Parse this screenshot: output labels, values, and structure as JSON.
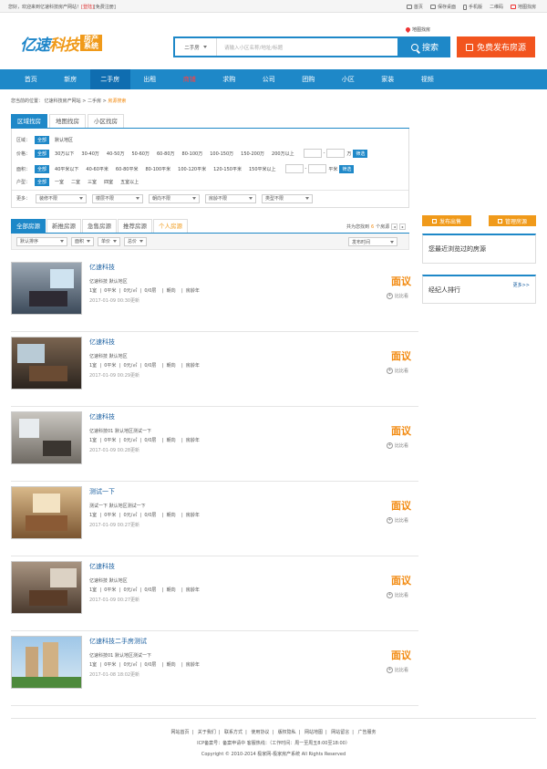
{
  "topbar": {
    "welcome": "您好，欢迎来到亿速科技房产网站！",
    "login": "[登陆]",
    "register": "[免费注册]",
    "links": [
      "首页",
      "保存桌面",
      "手机版",
      "二维码",
      "地图找房"
    ]
  },
  "header": {
    "logo_part1": "亿速",
    "logo_part2": "科技",
    "logo_box": "房产系统",
    "map_link": "地图找房",
    "search_type": "二手房",
    "search_placeholder": "请输入小区名称/地址/标题",
    "search_button": "搜索",
    "publish_button": "免费发布房源"
  },
  "nav": [
    "首页",
    "新房",
    "二手房",
    "出租",
    "商铺",
    "求购",
    "公司",
    "团购",
    "小区",
    "家装",
    "视频"
  ],
  "breadcrumb": {
    "prefix": "您当前的位置：",
    "path": "亿速科技房产网站 > 二手房 >",
    "current": "房源搜索"
  },
  "filter": {
    "tabs": [
      "区域找房",
      "地图找房",
      "小区找房"
    ],
    "all_label": "全部",
    "area": {
      "label": "区域：",
      "items": [
        "默认地区"
      ]
    },
    "price": {
      "label": "价格：",
      "items": [
        "30万以下",
        "30-40万",
        "40-50万",
        "50-60万",
        "60-80万",
        "80-100万",
        "100-150万",
        "150-200万",
        "200万以上"
      ],
      "unit": "万",
      "button": "筛选"
    },
    "size": {
      "label": "面积：",
      "items": [
        "40平米以下",
        "40-60平米",
        "60-80平米",
        "80-100平米",
        "100-120平米",
        "120-150平米",
        "150平米以上"
      ],
      "unit": "平米",
      "button": "筛选"
    },
    "type": {
      "label": "户型：",
      "items": [
        "一室",
        "二室",
        "三室",
        "四室",
        "五室以上"
      ]
    },
    "more": {
      "label": "更多：",
      "dropdowns": [
        "装修不限",
        "楼层不限",
        "朝向不限",
        "房龄不限",
        "类型不限"
      ]
    }
  },
  "list": {
    "tabs": [
      "全部房源",
      "新推房源",
      "急售房源",
      "推荐房源",
      "个人房源"
    ],
    "found_prefix": "共为您找到",
    "found_count": "6",
    "found_suffix": "个房源",
    "page_prev": "◂",
    "page_next": "▸",
    "sort": {
      "default": "默认排序",
      "area": "面积",
      "unit": "单价",
      "total": "总价",
      "time": "发布时间"
    },
    "compare_label": "比比看",
    "items": [
      {
        "title": "亿速科技",
        "sub": "亿速科技  默认地区",
        "info": "1室  |  0平米  |  0元/㎡  |  0/0层    |  朝向    |  房龄年",
        "date": "2017-01-09 00:30更新",
        "price": "面议"
      },
      {
        "title": "亿速科技",
        "sub": "亿速科技  默认地区",
        "info": "1室  |  0平米  |  0元/㎡  |  0/0层    |  朝向    |  房龄年",
        "date": "2017-01-09 00:29更新",
        "price": "面议"
      },
      {
        "title": "亿速科技",
        "sub": "亿速科技01  默认地区测试一下",
        "info": "1室  |  0平米  |  0元/㎡  |  0/0层    |  朝向    |  房龄年",
        "date": "2017-01-09 00:28更新",
        "price": "面议"
      },
      {
        "title": "测试一下",
        "sub": "测试一下  默认地区测试一下",
        "info": "1室  |  0平米  |  0元/㎡  |  0/0层    |  朝向    |  房龄年",
        "date": "2017-01-09 00:27更新",
        "price": "面议"
      },
      {
        "title": "亿速科技",
        "sub": "亿速科技  默认地区",
        "info": "1室  |  0平米  |  0元/㎡  |  0/0层    |  朝向    |  房龄年",
        "date": "2017-01-09 00:27更新",
        "price": "面议"
      },
      {
        "title": "亿速科技二手房测试",
        "sub": "亿速科技01  默认地区测试一下",
        "info": "1室  |  0平米  |  0元/㎡  |  0/0层    |  朝向    |  房龄年",
        "date": "2017-01-08 18:02更新",
        "price": "面议"
      }
    ]
  },
  "sidebar": {
    "publish_sale": "发布出售",
    "manage": "管理房源",
    "recent_title": "您最近浏览过的房源",
    "agent_title": "经纪人排行",
    "agent_more": "更多>>"
  },
  "footer": {
    "links": [
      "网站首页",
      "关于我们",
      "联系方式",
      "使用协议",
      "版权隐私",
      "网站地图",
      "网站留言",
      "广告服务"
    ],
    "icp": "ICP备案号：备案申请中  客服热线：（工作时间：周一至周五8:00至18:00）",
    "copyright": "Copyright © 2010-2014 极家网-极家房产系统 All Rights Reserved"
  },
  "colors": {
    "brand_blue": "#1e88c8",
    "accent_orange": "#f09a1a",
    "price_orange": "#f28a10",
    "publish_red": "#f2541e"
  }
}
